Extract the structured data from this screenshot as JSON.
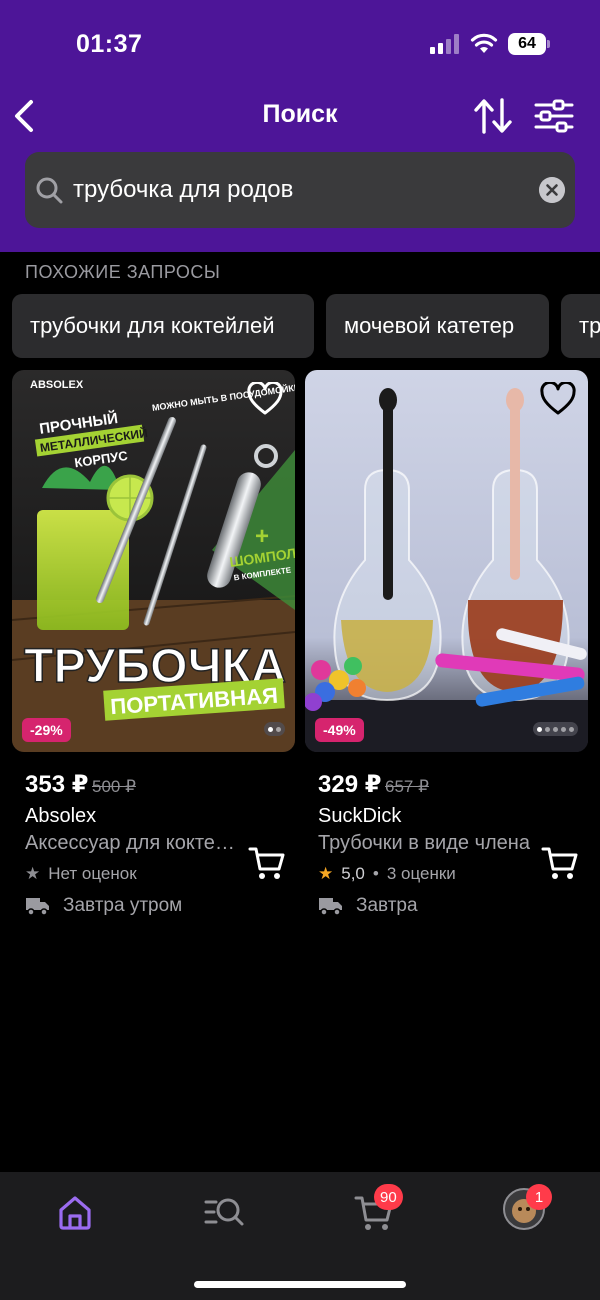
{
  "status": {
    "time": "01:37",
    "battery": "64"
  },
  "header": {
    "title": "Поиск"
  },
  "search": {
    "value": "трубочка для родов"
  },
  "suggestions": {
    "title": "ПОХОЖИЕ ЗАПРОСЫ",
    "chips": [
      "трубочки для коктейлей",
      "мочевой катетер",
      "тр"
    ]
  },
  "products": [
    {
      "image_text": {
        "brand_logo": "ABSOLEX",
        "line1": "ПРОЧНЫЙ",
        "line2": "МЕТАЛЛИЧЕСКИЙ",
        "line3": "КОРПУС",
        "wash": "МОЖНО МЫТЬ В ПОСУДОМОЙКЕ",
        "ramrod": "ШОМПОЛ",
        "ramrod2": "В КОМПЛЕКТЕ",
        "big": "ТРУБОЧКА",
        "big2": "ПОРТАТИВНАЯ"
      },
      "discount": "-29%",
      "price": "353 ₽",
      "old_price": "500 ₽",
      "brand": "Absolex",
      "description": "Аксессуар для коктейлей",
      "rating_text": "Нет оценок",
      "delivery": "Завтра утром",
      "dots": 2
    },
    {
      "discount": "-49%",
      "price": "329 ₽",
      "old_price": "657 ₽",
      "brand": "SuckDick",
      "description": "Трубочки в виде члена",
      "rating_value": "5,0",
      "rating_count": "3 оценки",
      "delivery": "Завтра",
      "dots": 5
    }
  ],
  "tabbar": {
    "cart_badge": "90",
    "profile_badge": "1"
  },
  "colors": {
    "header": "#4d1598",
    "accent": "#9b6cf0",
    "discount": "#d6246e",
    "badge": "#ff3b4a",
    "star": "#f5a623"
  }
}
